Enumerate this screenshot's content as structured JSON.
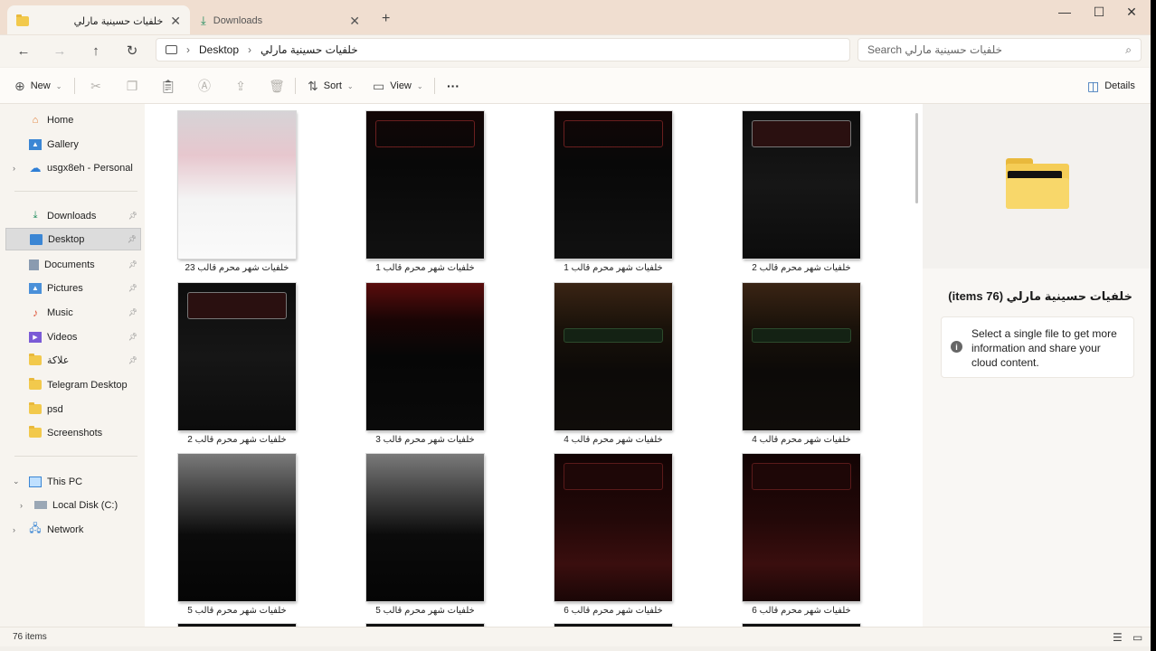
{
  "window": {
    "tabs": [
      {
        "label": "خلفيات حسينية مارلي",
        "icon": "folder-icon",
        "active": true
      },
      {
        "label": "Downloads",
        "icon": "download-icon",
        "active": false
      }
    ],
    "controls": {
      "minimize": "—",
      "maximize": "☐",
      "close": "✕"
    }
  },
  "navigation": {
    "breadcrumb": [
      "Desktop",
      "خلفيات حسينية مارلي"
    ],
    "search_placeholder": "Search خلفيات حسينية مارلي"
  },
  "toolbar": {
    "new_label": "New",
    "sort_label": "Sort",
    "view_label": "View",
    "more_label": "···",
    "details_label": "Details"
  },
  "sidebar": {
    "top": [
      {
        "label": "Home",
        "icon": "home-icon"
      },
      {
        "label": "Gallery",
        "icon": "gallery-icon"
      },
      {
        "label": "usgx8eh - Personal",
        "icon": "cloud-icon"
      }
    ],
    "quick": [
      {
        "label": "Downloads",
        "icon": "download-icon",
        "pinned": true
      },
      {
        "label": "Desktop",
        "icon": "desktop-icon",
        "pinned": true,
        "selected": true
      },
      {
        "label": "Documents",
        "icon": "document-icon",
        "pinned": true
      },
      {
        "label": "Pictures",
        "icon": "pictures-icon",
        "pinned": true
      },
      {
        "label": "Music",
        "icon": "music-icon",
        "pinned": true
      },
      {
        "label": "Videos",
        "icon": "videos-icon",
        "pinned": true
      },
      {
        "label": "علاكة",
        "icon": "folder-icon",
        "pinned": true
      },
      {
        "label": "Telegram Desktop",
        "icon": "folder-icon"
      },
      {
        "label": "psd",
        "icon": "folder-icon"
      },
      {
        "label": "Screenshots",
        "icon": "folder-icon"
      }
    ],
    "bottom": [
      {
        "label": "This PC",
        "icon": "computer-icon"
      },
      {
        "label": "Local Disk (C:)",
        "icon": "drive-icon"
      },
      {
        "label": "Network",
        "icon": "network-icon"
      }
    ]
  },
  "files": [
    {
      "name": "خلفيات شهر محرم قالب 23",
      "style": "light"
    },
    {
      "name": "خلفيات شهر محرم قالب 1",
      "style": "dark-red"
    },
    {
      "name": "خلفيات شهر محرم قالب 1",
      "style": "dark-red"
    },
    {
      "name": "خلفيات شهر محرم قالب 2",
      "style": "dark-banner"
    },
    {
      "name": "خلفيات شهر محرم قالب 2",
      "style": "dark-banner"
    },
    {
      "name": "خلفيات شهر محرم قالب 3",
      "style": "shrine-red"
    },
    {
      "name": "خلفيات شهر محرم قالب 4",
      "style": "shrine-night"
    },
    {
      "name": "خلفيات شهر محرم قالب 4",
      "style": "shrine-night"
    },
    {
      "name": "خلفيات شهر محرم قالب 5",
      "style": "grey-art"
    },
    {
      "name": "خلفيات شهر محرم قالب 5",
      "style": "grey-art"
    },
    {
      "name": "خلفيات شهر محرم قالب 6",
      "style": "crowd-gold"
    },
    {
      "name": "خلفيات شهر محرم قالب 6",
      "style": "crowd-gold"
    }
  ],
  "details_pane": {
    "title": "خلفيات حسينية مارلي (76 items)",
    "message": "Select a single file to get more information and share your cloud content."
  },
  "status": {
    "count": "76 items"
  }
}
